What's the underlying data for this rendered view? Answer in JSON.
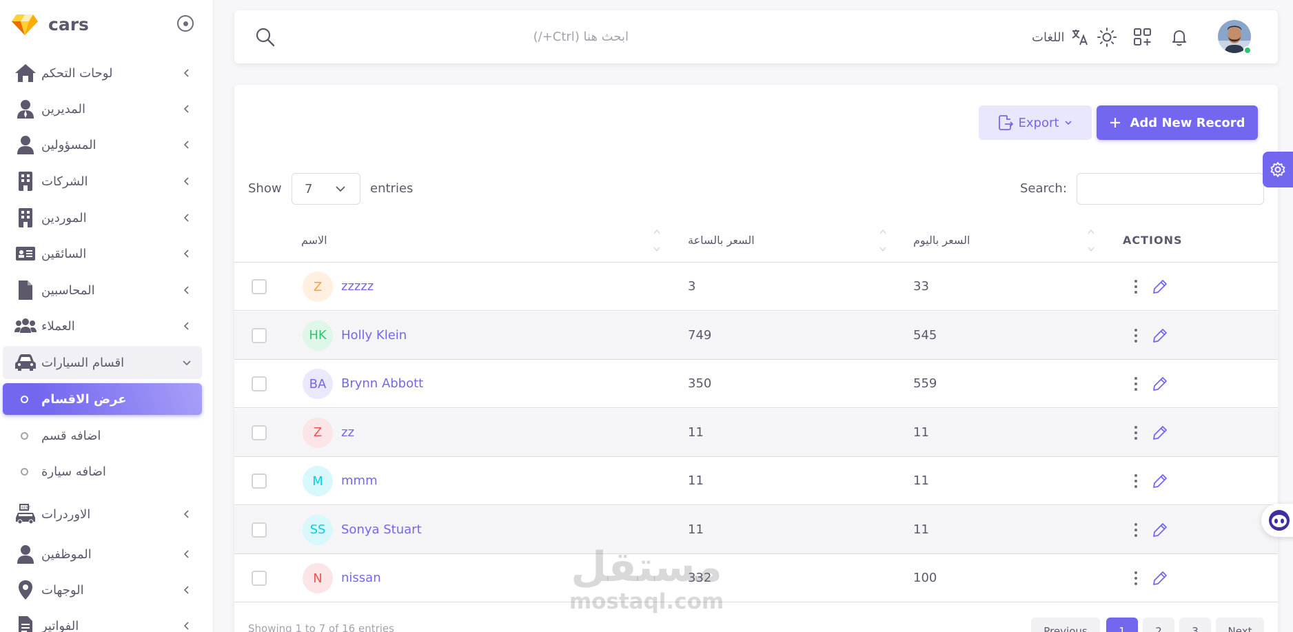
{
  "app": {
    "name": "cars"
  },
  "sidebar": {
    "items": [
      {
        "label": "لوحات التحكم",
        "icon": "home-icon"
      },
      {
        "label": "المديرين",
        "icon": "manager-icon"
      },
      {
        "label": "المسؤولين",
        "icon": "user-icon"
      },
      {
        "label": "الشركات",
        "icon": "building-icon"
      },
      {
        "label": "الموردين",
        "icon": "building-icon"
      },
      {
        "label": "السائقين",
        "icon": "id-card-icon"
      },
      {
        "label": "المحاسبين",
        "icon": "document-icon"
      },
      {
        "label": "العملاء",
        "icon": "users-group-icon"
      },
      {
        "label": "اقسام السيارات",
        "icon": "car-icon"
      }
    ],
    "sub_items": [
      {
        "label": "عرض الاقسام"
      },
      {
        "label": "اضافه قسم"
      },
      {
        "label": "اضافه سيارة"
      }
    ],
    "items_after": [
      {
        "label": "الاوردرات",
        "icon": "orders-icon"
      },
      {
        "label": "الموظفين",
        "icon": "user-icon"
      },
      {
        "label": "الوجهات",
        "icon": "map-pin-icon"
      },
      {
        "label": "الفواتير",
        "icon": "invoice-icon"
      }
    ]
  },
  "topbar": {
    "search_placeholder": "ابحث هنا (Ctrl+/)",
    "language_label": "اللغات"
  },
  "toolbar": {
    "export_label": "Export",
    "add_label": "Add New Record"
  },
  "table_controls": {
    "show_label": "Show",
    "page_size": "7",
    "entries_label": "entries",
    "search_label": "Search:"
  },
  "table": {
    "headers": {
      "name": "الاسم",
      "hourly_price": "السعر بالساعة",
      "daily_price": "السعر باليوم",
      "actions": "ACTIONS"
    },
    "rows": [
      {
        "initials": "Z",
        "name": "zzzzz",
        "hourly": "3",
        "daily": "33",
        "bg": "#fff0e1",
        "fg": "#ff9f43"
      },
      {
        "initials": "HK",
        "name": "Holly Klein",
        "hourly": "749",
        "daily": "545",
        "bg": "#dff7e9",
        "fg": "#28c76f"
      },
      {
        "initials": "BA",
        "name": "Brynn Abbott",
        "hourly": "350",
        "daily": "559",
        "bg": "#eae8fd",
        "fg": "#7367f0"
      },
      {
        "initials": "Z",
        "name": "zz",
        "hourly": "11",
        "daily": "11",
        "bg": "#fce5e6",
        "fg": "#ea5455"
      },
      {
        "initials": "M",
        "name": "mmm",
        "hourly": "11",
        "daily": "11",
        "bg": "#d9f8fc",
        "fg": "#00cfe8"
      },
      {
        "initials": "SS",
        "name": "Sonya Stuart",
        "hourly": "11",
        "daily": "11",
        "bg": "#d9f8fc",
        "fg": "#00cfe8"
      },
      {
        "initials": "N",
        "name": "nissan",
        "hourly": "332",
        "daily": "100",
        "bg": "#fce5e6",
        "fg": "#ea5455"
      }
    ]
  },
  "footer": {
    "info": "Showing 1 to 7 of 16 entries",
    "pagination": [
      "Previous",
      "1",
      "2",
      "3",
      "Next"
    ]
  },
  "watermark": {
    "line1": "مستقل",
    "line2": "mostaql.com"
  },
  "colors": {
    "primary": "#7367f0",
    "text": "#5d586c",
    "muted": "#a5a2ad"
  }
}
